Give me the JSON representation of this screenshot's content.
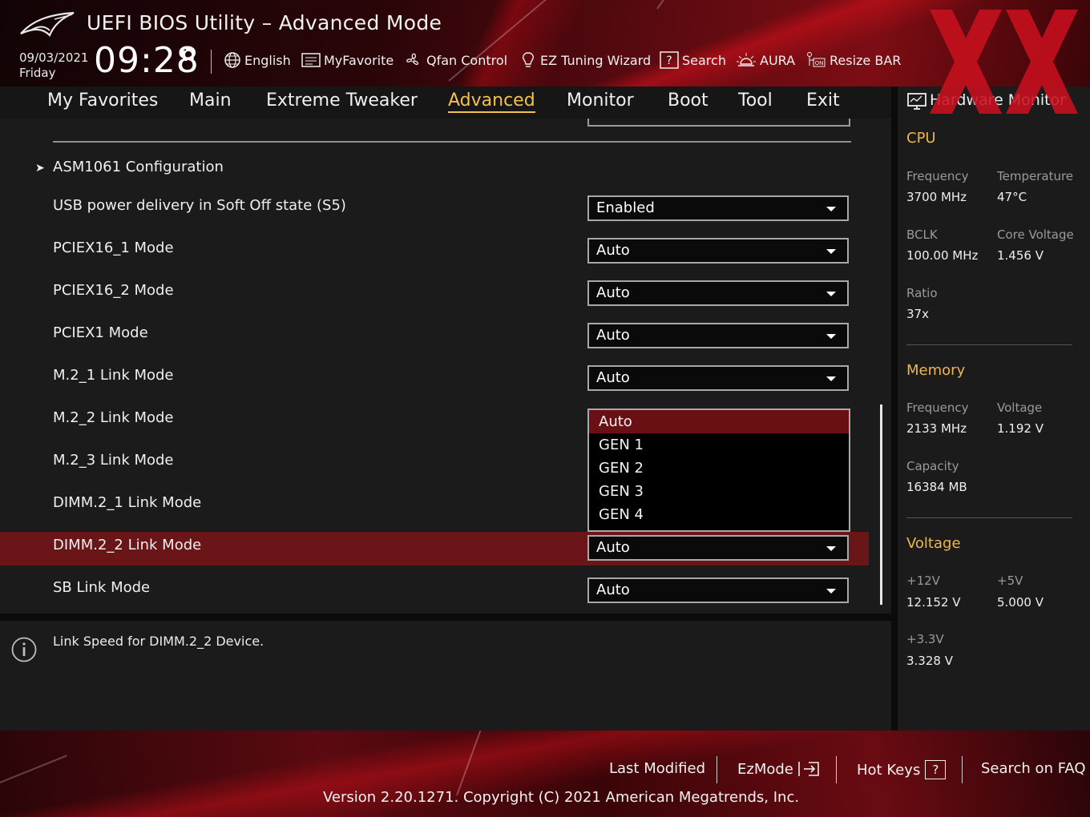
{
  "header": {
    "title": "UEFI BIOS Utility – Advanced Mode",
    "date": "09/03/2021",
    "day": "Friday",
    "time": "09:28",
    "toolbar": {
      "language": "English",
      "my_favorite": "MyFavorite",
      "qfan": "Qfan Control",
      "ez_tuning": "EZ Tuning Wizard",
      "search": "Search",
      "aura": "AURA",
      "resize_bar": "Resize BAR"
    }
  },
  "menu": {
    "tabs": [
      {
        "label": "My Favorites"
      },
      {
        "label": "Main"
      },
      {
        "label": "Extreme Tweaker"
      },
      {
        "label": "Advanced",
        "active": true
      },
      {
        "label": "Monitor"
      },
      {
        "label": "Boot"
      },
      {
        "label": "Tool"
      },
      {
        "label": "Exit"
      }
    ]
  },
  "main": {
    "submenu": "ASM1061 Configuration",
    "settings": [
      {
        "label": "USB power delivery in Soft Off state (S5)",
        "value": "Enabled"
      },
      {
        "label": "PCIEX16_1 Mode",
        "value": "Auto"
      },
      {
        "label": "PCIEX16_2 Mode",
        "value": "Auto"
      },
      {
        "label": "PCIEX1 Mode",
        "value": "Auto"
      },
      {
        "label": "M.2_1 Link Mode",
        "value": "Auto"
      },
      {
        "label": "M.2_2 Link Mode",
        "value": ""
      },
      {
        "label": "M.2_3 Link Mode",
        "value": ""
      },
      {
        "label": "DIMM.2_1 Link Mode",
        "value": ""
      },
      {
        "label": "DIMM.2_2 Link Mode",
        "value": "Auto",
        "highlighted": true
      },
      {
        "label": "SB Link Mode",
        "value": "Auto"
      }
    ],
    "dropdown": {
      "options": [
        "Auto",
        "GEN 1",
        "GEN 2",
        "GEN 3",
        "GEN 4"
      ],
      "selected": "Auto"
    }
  },
  "help": {
    "text": "Link Speed for DIMM.2_2 Device."
  },
  "hardware_monitor": {
    "title": "Hardware Monitor",
    "cpu": {
      "heading": "CPU",
      "frequency_label": "Frequency",
      "frequency": "3700 MHz",
      "temperature_label": "Temperature",
      "temperature": "47°C",
      "bclk_label": "BCLK",
      "bclk": "100.00 MHz",
      "core_voltage_label": "Core Voltage",
      "core_voltage": "1.456 V",
      "ratio_label": "Ratio",
      "ratio": "37x"
    },
    "memory": {
      "heading": "Memory",
      "frequency_label": "Frequency",
      "frequency": "2133 MHz",
      "voltage_label": "Voltage",
      "voltage": "1.192 V",
      "capacity_label": "Capacity",
      "capacity": "16384 MB"
    },
    "voltage": {
      "heading": "Voltage",
      "v12_label": "+12V",
      "v12": "12.152 V",
      "v5_label": "+5V",
      "v5": "5.000 V",
      "v33_label": "+3.3V",
      "v33": "3.328 V"
    }
  },
  "footer": {
    "last_modified": "Last Modified",
    "ezmode": "EzMode",
    "hot_keys": "Hot Keys",
    "hot_keys_glyph": "?",
    "faq": "Search on FAQ",
    "version": "Version 2.20.1271. Copyright (C) 2021 American Megatrends, Inc."
  },
  "colors": {
    "accent": "#f4c04e",
    "highlight_row": "#6a1518",
    "brand_red": "#c8101e"
  }
}
